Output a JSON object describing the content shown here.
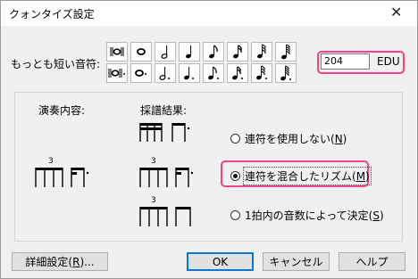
{
  "window": {
    "title": "クォンタイズ設定",
    "close_glyph": "✕"
  },
  "shortest_note": {
    "label": "もっとも短い音符:"
  },
  "edu": {
    "value": "204",
    "unit": "EDU"
  },
  "group": {
    "performance_label": "演奏内容:",
    "notation_label": "採譜結果:",
    "tuplet_number": "3",
    "options": [
      {
        "label": "連符を使用しない(",
        "key": "N",
        "tail": ")",
        "selected": false
      },
      {
        "label": "連符を混合したリズム(",
        "key": "M",
        "tail": ")",
        "selected": true
      },
      {
        "label": "1拍内の音数によって決定(",
        "key": "S",
        "tail": ")",
        "selected": false
      }
    ]
  },
  "buttons": {
    "advanced": "詳細設定(R)...",
    "advanced_pre": "詳細設定(",
    "advanced_key": "R",
    "advanced_tail": ")...",
    "ok": "OK",
    "cancel": "キャンセル",
    "help": "ヘルプ"
  },
  "colors": {
    "highlight": "#f0438a",
    "dialog_bg": "#f0f0f0",
    "default_button_border": "#0078d7"
  },
  "icons": {
    "row1": [
      "double-whole-note-icon",
      "whole-note-icon",
      "half-note-icon",
      "quarter-note-icon",
      "eighth-note-icon",
      "sixteenth-note-icon",
      "thirty-second-note-icon",
      "sixty-fourth-note-icon"
    ],
    "row2": [
      "dotted-double-whole-note-icon",
      "dotted-whole-note-icon",
      "dotted-half-note-icon",
      "dotted-quarter-note-icon",
      "dotted-eighth-note-icon",
      "dotted-sixteenth-note-icon",
      "dotted-thirty-second-note-icon",
      "dotted-sixty-fourth-note-icon"
    ]
  }
}
